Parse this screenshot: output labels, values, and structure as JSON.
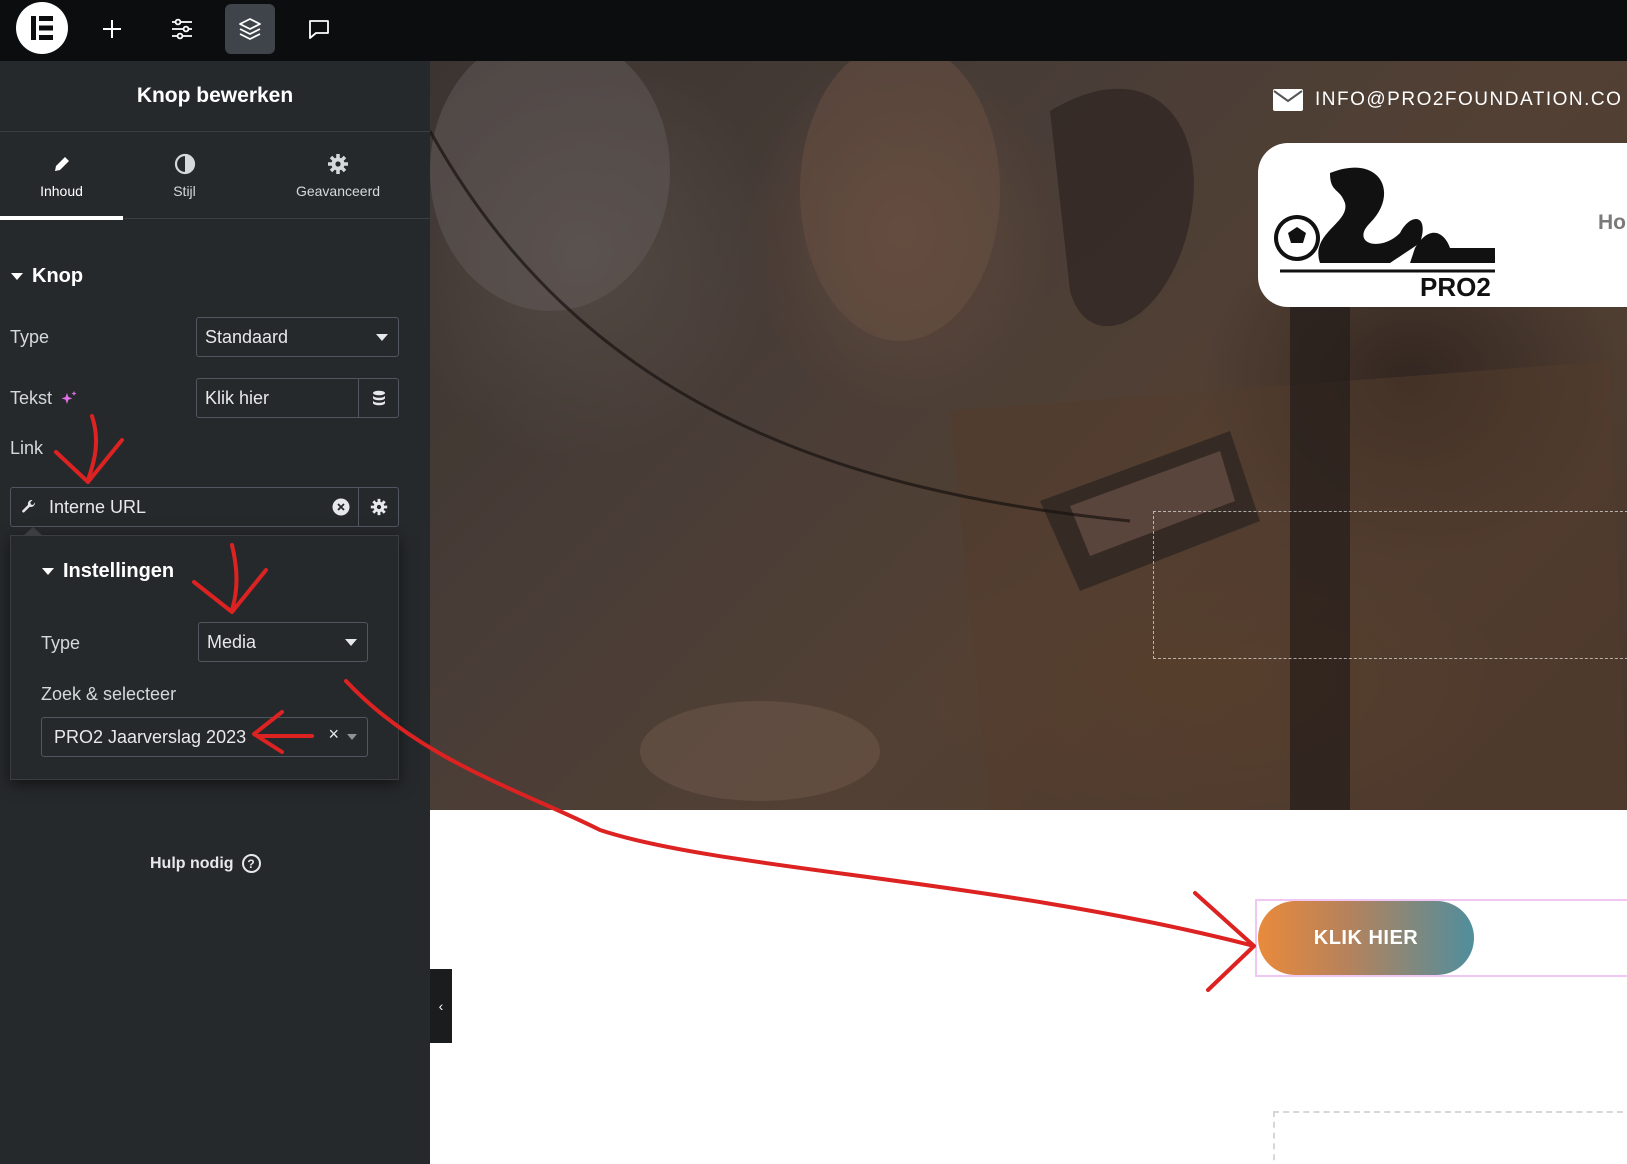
{
  "toolbar": {
    "logo_icon": "elementor-logo-icon",
    "add_icon": "plus-icon",
    "settings_icon": "sliders-icon",
    "structure_icon": "layers-icon",
    "comments_icon": "chat-icon"
  },
  "panel": {
    "title": "Knop bewerken",
    "tabs": [
      {
        "label": "Inhoud",
        "icon": "pencil-icon",
        "active": true
      },
      {
        "label": "Stijl",
        "icon": "half-circle-icon",
        "active": false
      },
      {
        "label": "Geavanceerd",
        "icon": "gear-icon",
        "active": false
      }
    ],
    "section_title": "Knop",
    "type_label": "Type",
    "type_value": "Standaard",
    "text_label": "Tekst",
    "text_value": "Klik hier",
    "link_label": "Link",
    "link_value": "Interne URL",
    "popover": {
      "title": "Instellingen",
      "type_label": "Type",
      "type_value": "Media",
      "search_label": "Zoek & selecteer",
      "search_value": "PRO2 Jaarverslag 2023",
      "clear_glyph": "×"
    },
    "help_text": "Hulp nodig",
    "help_icon": "?",
    "collapse_glyph": "‹"
  },
  "canvas": {
    "email": "INFO@PRO2FOUNDATION.CO",
    "logo_text": "PRO2",
    "nav_stub": "Ho",
    "button_label": "KLIK HIER"
  },
  "colors": {
    "sidebar_bg": "#26292c",
    "topbar_bg": "#0c0d0e",
    "annotation_red": "#dd2222",
    "button_gradient_start": "#e98a3c",
    "button_gradient_end": "#4f8e9d"
  }
}
